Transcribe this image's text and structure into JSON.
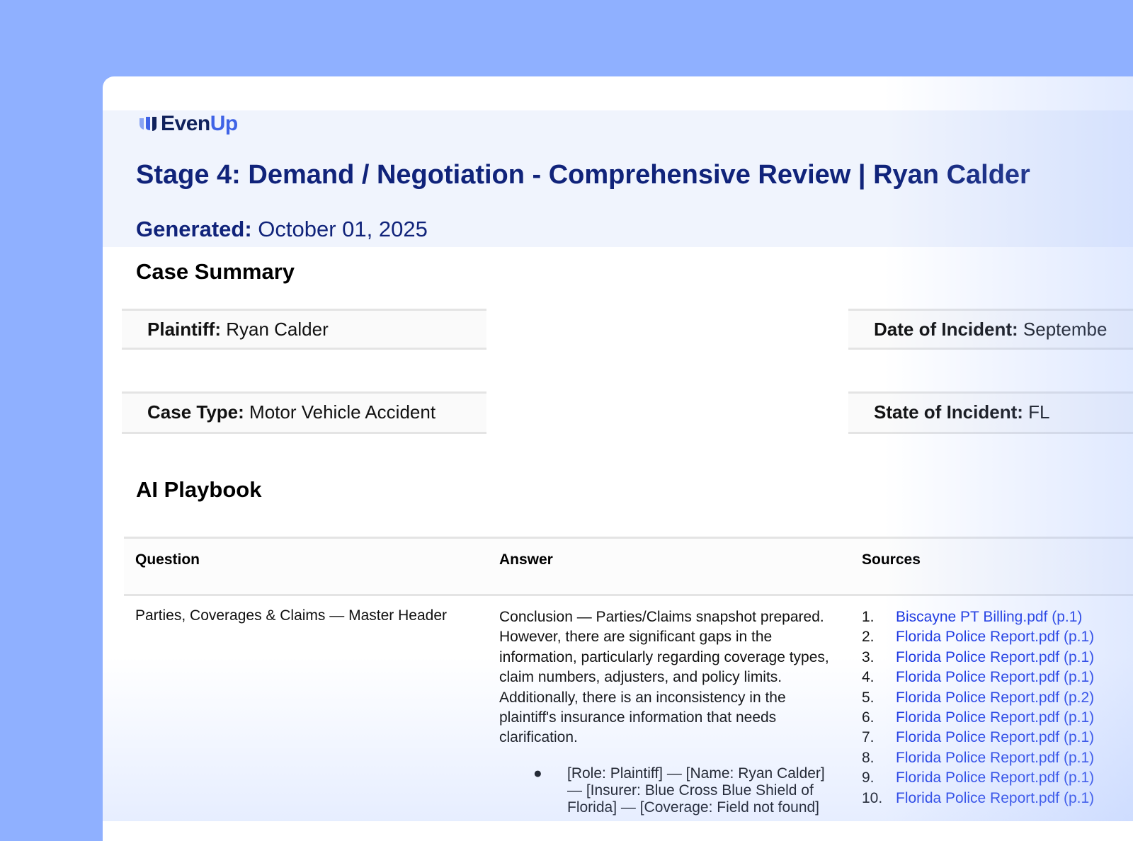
{
  "brand": {
    "logo_prefix": "Even",
    "logo_suffix": "Up"
  },
  "header": {
    "title": "Stage 4: Demand / Negotiation - Comprehensive Review | Ryan Calder",
    "generated_label": "Generated:",
    "generated_value": "October 01, 2025"
  },
  "case_summary": {
    "heading": "Case Summary",
    "plaintiff_label": "Plaintiff:",
    "plaintiff_value": "Ryan Calder",
    "date_label": "Date of Incident:",
    "date_value": "Septembe",
    "case_type_label": "Case Type:",
    "case_type_value": "Motor Vehicle Accident",
    "state_label": "State of Incident:",
    "state_value": "FL"
  },
  "playbook": {
    "heading": "AI Playbook",
    "columns": {
      "question": "Question",
      "answer": "Answer",
      "sources": "Sources"
    },
    "rows": [
      {
        "question": "Parties, Coverages & Claims — Master Header",
        "answer": "Conclusion — Parties/Claims snapshot prepared. However, there are significant gaps in the information, particularly regarding coverage types, claim numbers, adjusters, and policy limits. Additionally, there is an inconsistency in the plaintiff's insurance information that needs clarification.",
        "bullets": [
          "[Role: Plaintiff] — [Name: Ryan Calder] — [Insurer: Blue Cross Blue Shield of Florida] — [Coverage: Field not found]"
        ],
        "sources": [
          {
            "num": "1.",
            "label": "Biscayne PT Billing.pdf (p.1)"
          },
          {
            "num": "2.",
            "label": "Florida Police Report.pdf (p.1)"
          },
          {
            "num": "3.",
            "label": "Florida Police Report.pdf (p.1)"
          },
          {
            "num": "4.",
            "label": "Florida Police Report.pdf (p.1)"
          },
          {
            "num": "5.",
            "label": "Florida Police Report.pdf (p.2)"
          },
          {
            "num": "6.",
            "label": "Florida Police Report.pdf (p.1)"
          },
          {
            "num": "7.",
            "label": "Florida Police Report.pdf (p.1)"
          },
          {
            "num": "8.",
            "label": "Florida Police Report.pdf (p.1)"
          },
          {
            "num": "9.",
            "label": "Florida Police Report.pdf (p.1)"
          },
          {
            "num": "10.",
            "label": "Florida Police Report.pdf (p.1)"
          }
        ]
      }
    ]
  },
  "colors": {
    "page_background": "#8fb0ff",
    "header_band": "#f0f4fd",
    "title_text": "#10237a",
    "logo_accent": "#3f63e6",
    "link": "#1a35e0"
  },
  "icons": {
    "logo_mark": "evenup-logo-icon"
  }
}
